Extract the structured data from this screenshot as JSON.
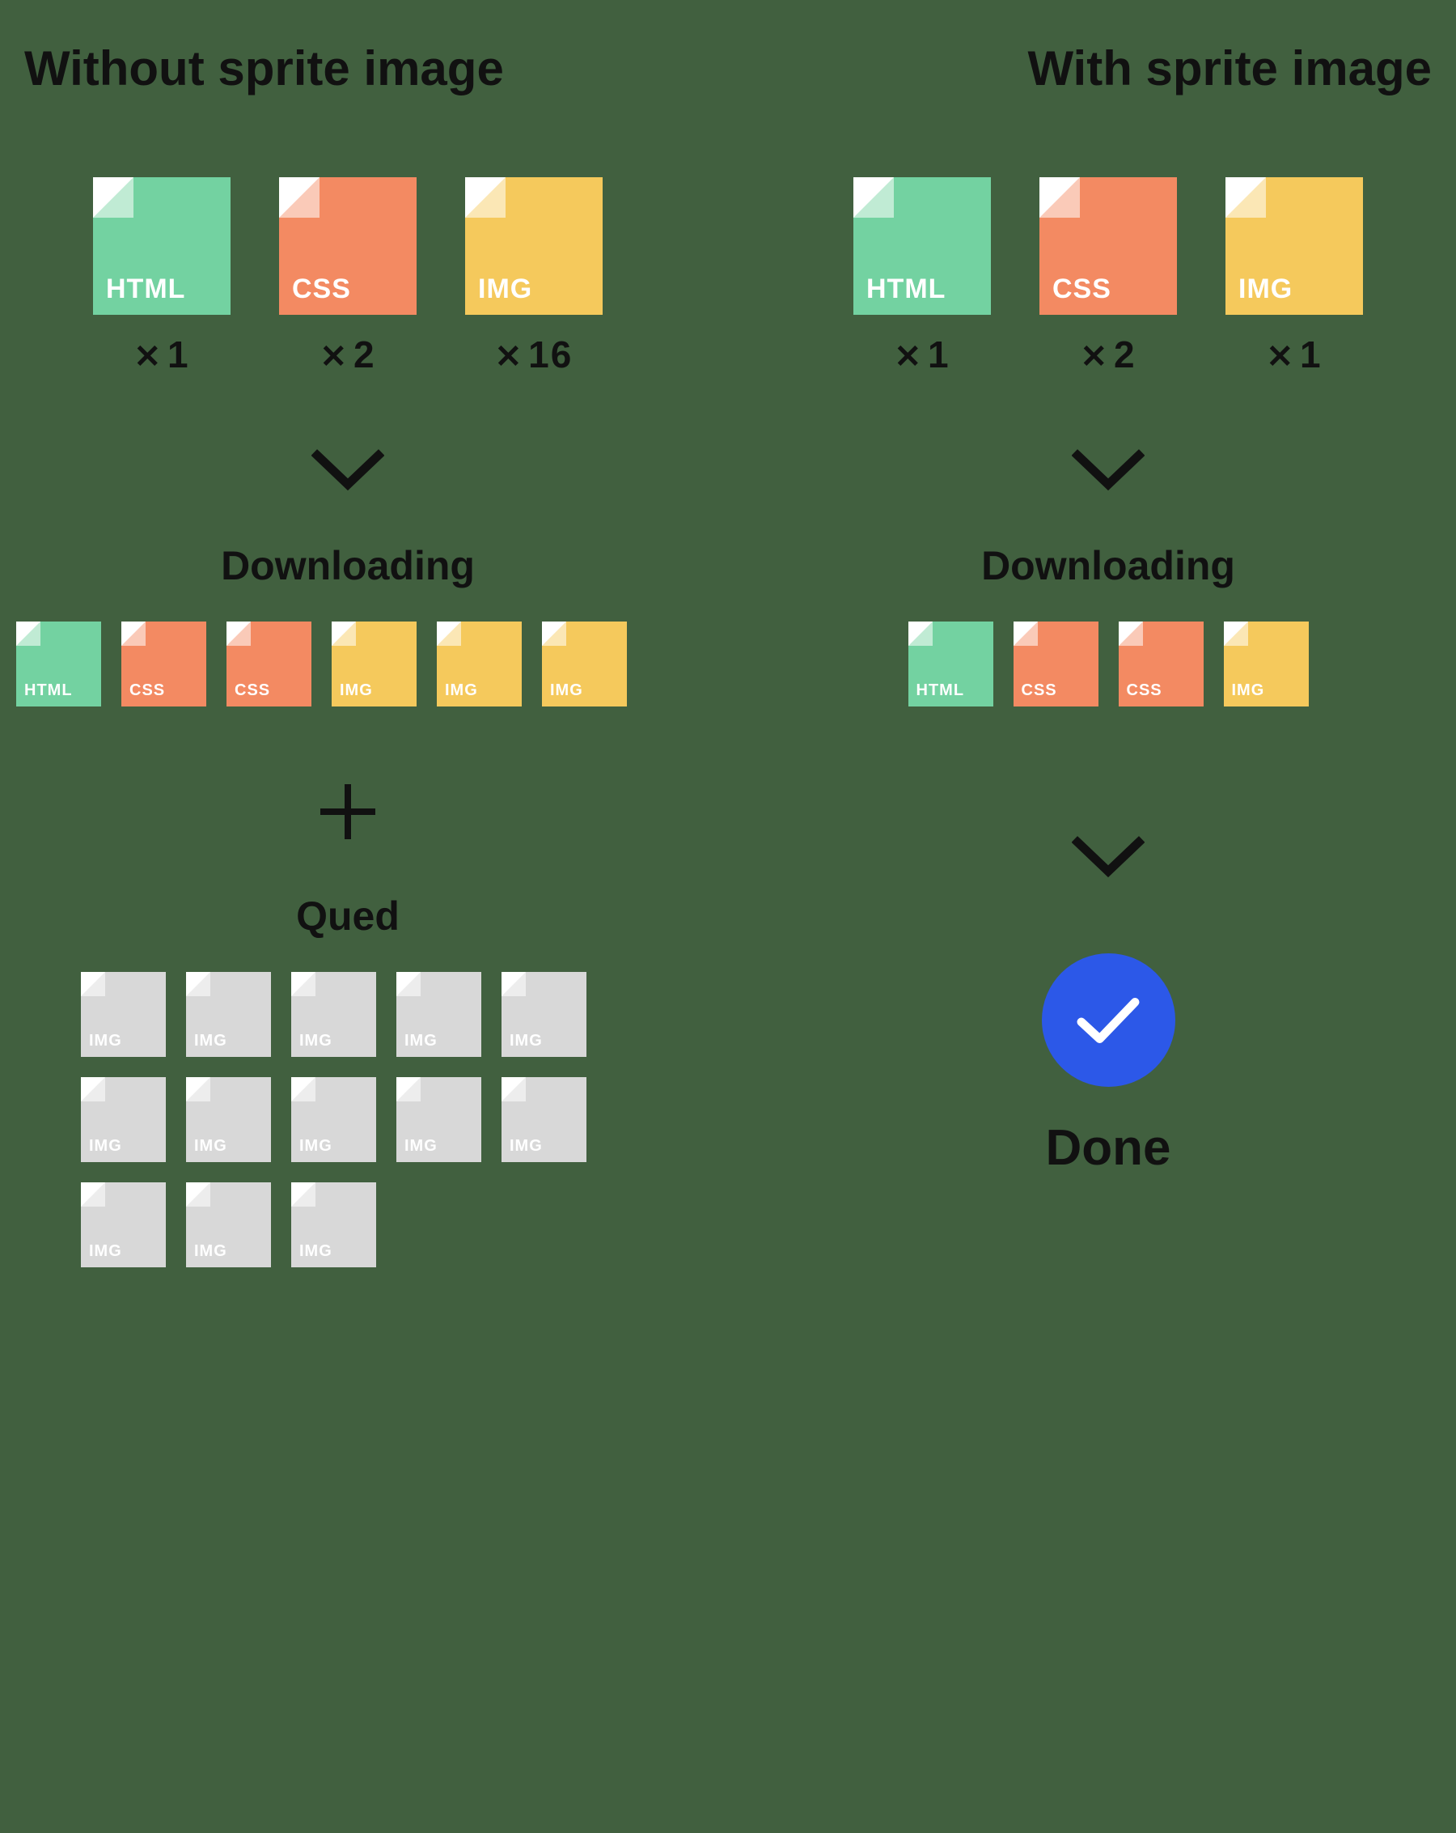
{
  "left": {
    "title": "Without sprite image",
    "files": [
      {
        "type": "HTML",
        "count": "1"
      },
      {
        "type": "CSS",
        "count": "2"
      },
      {
        "type": "IMG",
        "count": "16"
      }
    ],
    "downloadingLabel": "Downloading",
    "downloading": [
      "HTML",
      "CSS",
      "CSS",
      "IMG",
      "IMG",
      "IMG"
    ],
    "queuedLabel": "Qued",
    "queued": [
      "IMG",
      "IMG",
      "IMG",
      "IMG",
      "IMG",
      "IMG",
      "IMG",
      "IMG",
      "IMG",
      "IMG",
      "IMG",
      "IMG",
      "IMG"
    ]
  },
  "right": {
    "title": "With sprite image",
    "files": [
      {
        "type": "HTML",
        "count": "1"
      },
      {
        "type": "CSS",
        "count": "2"
      },
      {
        "type": "IMG",
        "count": "1"
      }
    ],
    "downloadingLabel": "Downloading",
    "downloading": [
      "HTML",
      "CSS",
      "CSS",
      "IMG"
    ],
    "doneLabel": "Done"
  },
  "multiply": "✕"
}
